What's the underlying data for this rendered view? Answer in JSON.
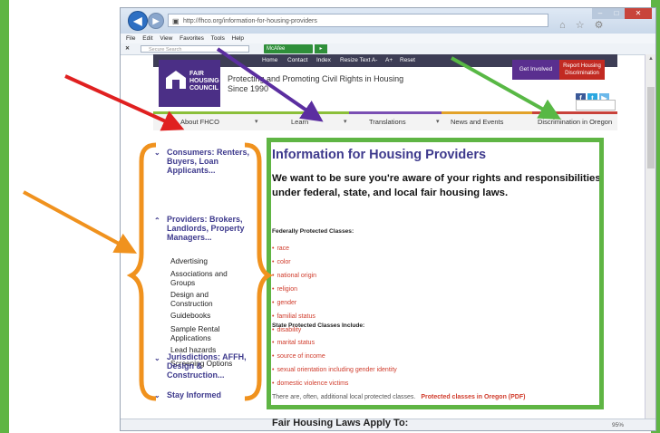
{
  "colors": {
    "green_frame": "#5fb544",
    "red_arrow": "#e02020",
    "purple_arrow": "#5b2ea0",
    "green_arrow": "#58b845",
    "orange_annot": "#f0921e",
    "site_purple": "#3e3a8d",
    "link_red": "#d03c2c"
  },
  "browser": {
    "url": "http://fhco.org/information-for-housing-providers",
    "url_controls": "▾ ⊟ ⊂ ✕",
    "toolbar_icons": "⌂ ☆ ⚙",
    "menu": [
      "File",
      "Edit",
      "View",
      "Favorites",
      "Tools",
      "Help"
    ],
    "search_placeholder": "Secure Search",
    "mcafee": "McAfee",
    "zoom": "95%"
  },
  "site": {
    "topnav": [
      "Home",
      "Contact",
      "Index",
      "Resize Text A-",
      "A+",
      "Reset"
    ],
    "logo_text": "FAIR HOUSING COUNCIL",
    "tagline": "Protecting and Promoting Civil Rights in Housing Since 1990",
    "get_involved": "Get Involved",
    "report": "Report Housing Discrimination",
    "social": [
      "f",
      "t",
      "▶"
    ]
  },
  "mainnav": [
    "About FHCO",
    "Learn",
    "Translations",
    "News and Events",
    "Discrimination in Oregon"
  ],
  "sidebar": {
    "consumers": "Consumers: Renters, Buyers, Loan Applicants...",
    "providers": "Providers: Brokers, Landlords, Property Managers...",
    "provider_items": [
      "Advertising",
      "Associations and Groups",
      "Design and Construction",
      "Guidebooks",
      "Sample Rental Applications",
      "Lead hazards",
      "Screening Options"
    ],
    "jurisdictions": "Jurisdictions: AFFH, Design & Construction...",
    "stay": "Stay Informed"
  },
  "content": {
    "title": "Information for Housing Providers",
    "intro": "We want to be sure you're aware of your rights and responsibilities under federal, state, and local fair housing laws.",
    "fed_heading": "Federally Protected Classes:",
    "fed_items": [
      "race",
      "color",
      "national origin",
      "religion",
      "gender",
      "familial status",
      "disability"
    ],
    "state_heading": "State Protected Classes Include:",
    "state_items": [
      "marital status",
      "source of income",
      "sexual orientation including gender identity",
      "domestic violence victims"
    ],
    "note": "There are, often, additional local protected classes.",
    "note_link": "Protected classes in Oregon (PDF)",
    "next_heading": "Fair Housing Laws Apply To:"
  }
}
